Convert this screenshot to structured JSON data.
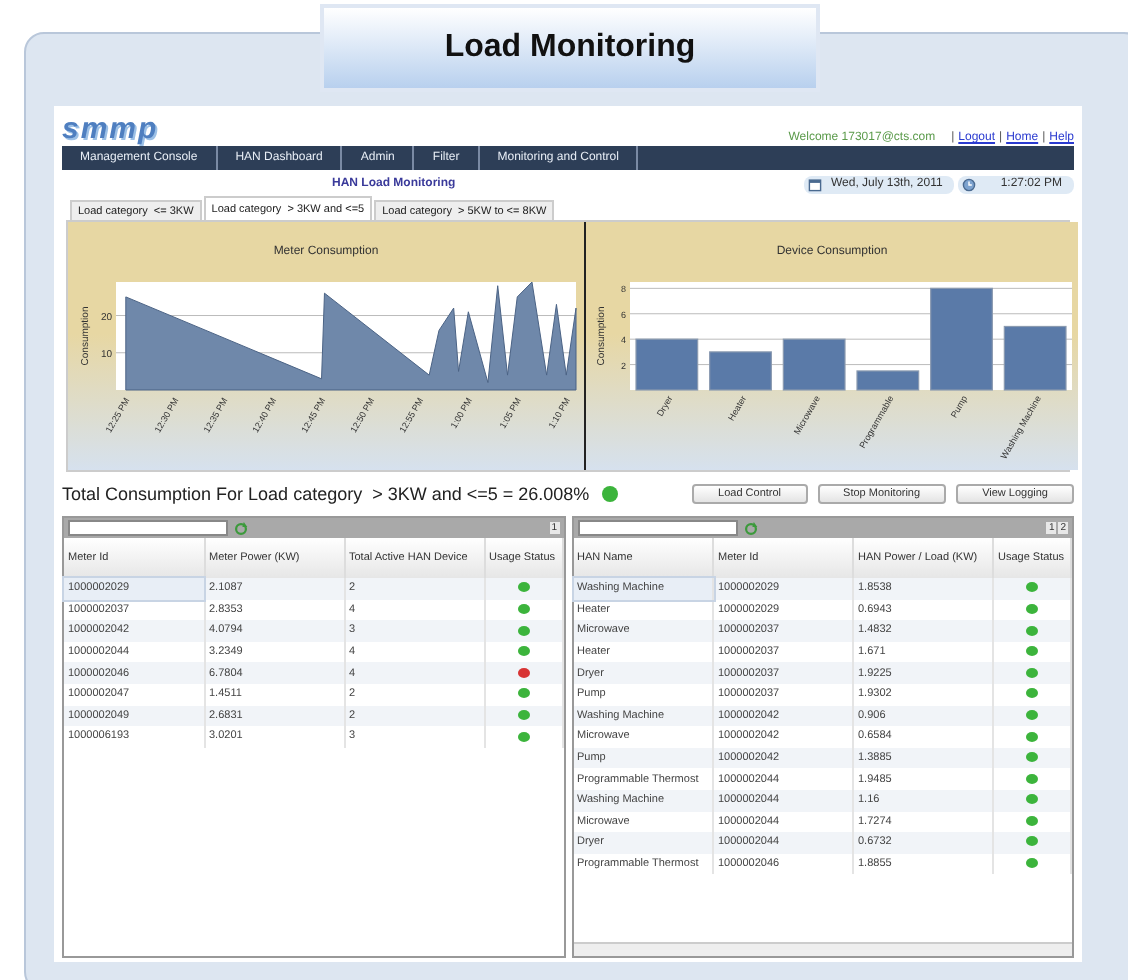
{
  "window": {
    "title": "Load Monitoring"
  },
  "header": {
    "logo": "smmp",
    "welcome": "Welcome 173017@cts.com",
    "separator": "|",
    "links": [
      "Logout",
      "Home",
      "Help"
    ]
  },
  "nav": [
    "Management Console",
    "HAN Dashboard",
    "Admin",
    "Filter",
    "Monitoring and Control"
  ],
  "page_title": "HAN Load Monitoring",
  "date": "Wed, July 13th, 2011",
  "time": "1:27:02 PM",
  "tabs": [
    {
      "label": "Load category  <= 3KW",
      "selected": false
    },
    {
      "label": "Load category  > 3KW and <=5",
      "selected": true
    },
    {
      "label": "Load category  > 5KW to <= 8KW",
      "selected": false
    }
  ],
  "meter_chart": {
    "chart_data": {
      "type": "area",
      "title": "Meter Consumption",
      "ylabel": "Consumption",
      "x": [
        12.4167,
        12.75,
        12.755,
        12.9333,
        12.95,
        12.975,
        12.9833,
        13,
        13.0333,
        13.05,
        13.0667,
        13.0833,
        13.1083,
        13.1333,
        13.15,
        13.1667,
        13.1833
      ],
      "series": [
        {
          "color": "#6f88aa",
          "values": [
            25,
            3,
            26,
            4,
            16,
            22,
            5,
            21,
            2,
            28,
            4,
            25,
            29,
            4,
            23,
            4,
            22
          ]
        }
      ],
      "xlim": [
        12.4,
        13.1833
      ],
      "ylim": [
        0,
        29
      ],
      "yticks": [
        10,
        20
      ],
      "grid": true,
      "xticks": [
        {
          "value": 12.4167,
          "label": "12:25 PM"
        },
        {
          "value": 12.5,
          "label": "12:30 PM"
        },
        {
          "value": 12.5833,
          "label": "12:35 PM"
        },
        {
          "value": 12.6667,
          "label": "12:40 PM"
        },
        {
          "value": 12.75,
          "label": "12:45 PM"
        },
        {
          "value": 12.8333,
          "label": "12:50 PM"
        },
        {
          "value": 12.9167,
          "label": "12:55 PM"
        },
        {
          "value": 13,
          "label": "1:00 PM"
        },
        {
          "value": 13.0833,
          "label": "1:05 PM"
        },
        {
          "value": 13.1667,
          "label": "1:10 PM"
        }
      ]
    }
  },
  "device_chart": {
    "chart_data": {
      "type": "bar",
      "title": "Device Consumption",
      "ylabel": "Consumption",
      "categories": [
        "Dryer",
        "Heater",
        "Microwave",
        "Programmable",
        "Pump",
        "Washing Machine"
      ],
      "series": [
        {
          "color": "#5a7aa8",
          "values": [
            4,
            3,
            4,
            1.5,
            8,
            5
          ]
        }
      ],
      "ylim": [
        0,
        8.5
      ],
      "yticks": [
        2,
        4,
        6,
        8
      ],
      "grid": true
    }
  },
  "summary": {
    "text": "Total Consumption For Load category  > 3KW and <=5 = 26.008%",
    "color": "#3cb43c"
  },
  "buttons": [
    "Load Control",
    "Stop Monitoring",
    "View Logging"
  ],
  "meter_table": {
    "pages": [
      "1"
    ],
    "columns": [
      "Meter Id",
      "Meter Power (KW)",
      "Total Active HAN Device",
      "Usage Status"
    ],
    "rows": [
      {
        "cells": [
          "1000002029",
          "2.1087",
          "2"
        ],
        "color": "#3cb43c",
        "selected": true
      },
      {
        "cells": [
          "1000002037",
          "2.8353",
          "4"
        ],
        "color": "#3cb43c",
        "selected": false
      },
      {
        "cells": [
          "1000002042",
          "4.0794",
          "3"
        ],
        "color": "#3cb43c",
        "selected": false
      },
      {
        "cells": [
          "1000002044",
          "3.2349",
          "4"
        ],
        "color": "#3cb43c",
        "selected": false
      },
      {
        "cells": [
          "1000002046",
          "6.7804",
          "4"
        ],
        "color": "#d83434",
        "selected": false
      },
      {
        "cells": [
          "1000002047",
          "1.4511",
          "2"
        ],
        "color": "#3cb43c",
        "selected": false
      },
      {
        "cells": [
          "1000002049",
          "2.6831",
          "2"
        ],
        "color": "#3cb43c",
        "selected": false
      },
      {
        "cells": [
          "1000006193",
          "3.0201",
          "3"
        ],
        "color": "#3cb43c",
        "selected": false
      }
    ]
  },
  "han_table": {
    "pages": [
      "1",
      "2"
    ],
    "columns": [
      "HAN Name",
      "Meter Id",
      "HAN Power / Load (KW)",
      "Usage Status"
    ],
    "rows": [
      {
        "cells": [
          "Washing Machine",
          "1000002029",
          "1.8538"
        ],
        "color": "#3cb43c",
        "selected": true
      },
      {
        "cells": [
          "Heater",
          "1000002029",
          "0.6943"
        ],
        "color": "#3cb43c",
        "selected": false
      },
      {
        "cells": [
          "Microwave",
          "1000002037",
          "1.4832"
        ],
        "color": "#3cb43c",
        "selected": false
      },
      {
        "cells": [
          "Heater",
          "1000002037",
          "1.671"
        ],
        "color": "#3cb43c",
        "selected": false
      },
      {
        "cells": [
          "Dryer",
          "1000002037",
          "1.9225"
        ],
        "color": "#3cb43c",
        "selected": false
      },
      {
        "cells": [
          "Pump",
          "1000002037",
          "1.9302"
        ],
        "color": "#3cb43c",
        "selected": false
      },
      {
        "cells": [
          "Washing Machine",
          "1000002042",
          "0.906"
        ],
        "color": "#3cb43c",
        "selected": false
      },
      {
        "cells": [
          "Microwave",
          "1000002042",
          "0.6584"
        ],
        "color": "#3cb43c",
        "selected": false
      },
      {
        "cells": [
          "Pump",
          "1000002042",
          "1.3885"
        ],
        "color": "#3cb43c",
        "selected": false
      },
      {
        "cells": [
          "Programmable Thermost",
          "1000002044",
          "1.9485"
        ],
        "color": "#3cb43c",
        "selected": false
      },
      {
        "cells": [
          "Washing Machine",
          "1000002044",
          "1.16"
        ],
        "color": "#3cb43c",
        "selected": false
      },
      {
        "cells": [
          "Microwave",
          "1000002044",
          "1.7274"
        ],
        "color": "#3cb43c",
        "selected": false
      },
      {
        "cells": [
          "Dryer",
          "1000002044",
          "0.6732"
        ],
        "color": "#3cb43c",
        "selected": false
      },
      {
        "cells": [
          "Programmable Thermost",
          "1000002046",
          "1.8855"
        ],
        "color": "#3cb43c",
        "selected": false
      }
    ]
  }
}
